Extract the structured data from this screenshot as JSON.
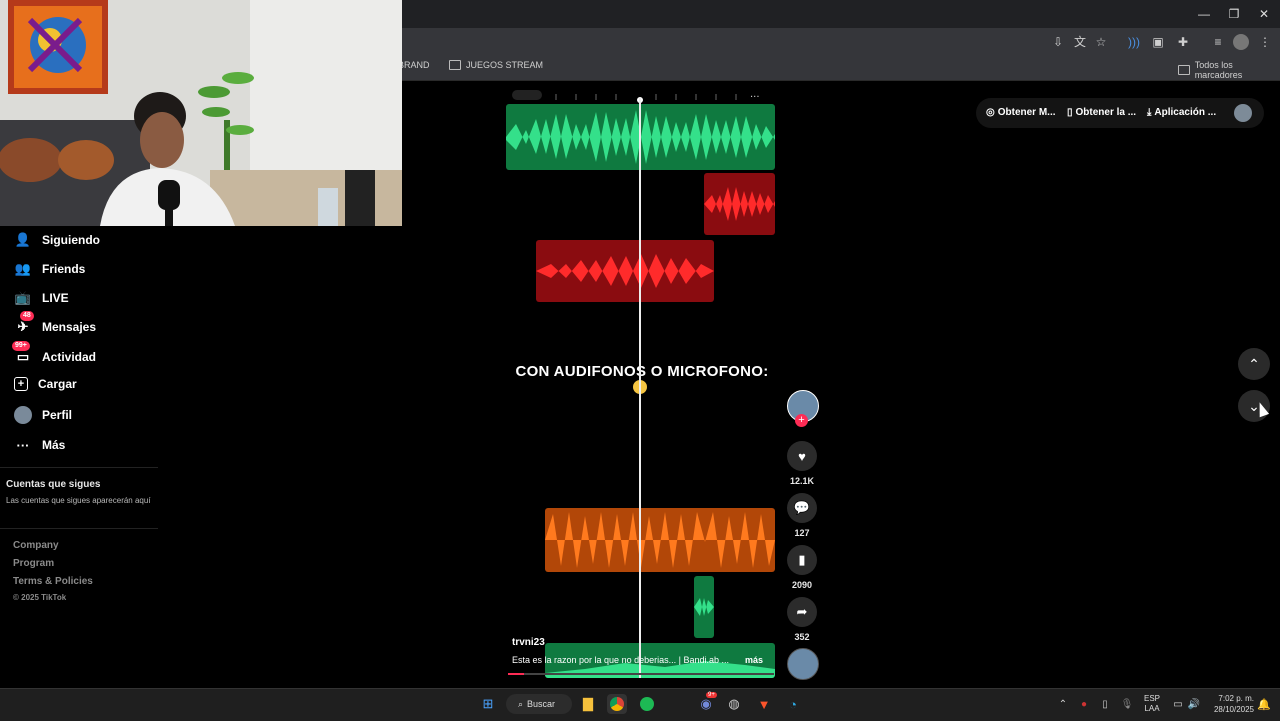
{
  "browser": {
    "bookmarks": [
      "BRAND",
      "JUEGOS STREAM"
    ],
    "all_bookmarks": "Todos los marcadores"
  },
  "sidebar": {
    "items": [
      {
        "label": "Siguiendo",
        "icon": "following-icon"
      },
      {
        "label": "Friends",
        "icon": "friends-icon"
      },
      {
        "label": "LIVE",
        "icon": "live-icon"
      },
      {
        "label": "Mensajes",
        "icon": "messages-icon",
        "badge": "48"
      },
      {
        "label": "Actividad",
        "icon": "activity-icon",
        "badge": "99+"
      },
      {
        "label": "Cargar",
        "icon": "upload-icon"
      },
      {
        "label": "Perfil",
        "icon": "profile-avatar"
      },
      {
        "label": "Más",
        "icon": "more-icon"
      }
    ],
    "following_title": "Cuentas que sigues",
    "following_desc": "Las cuentas que sigues aparecerán aquí",
    "footer": [
      "Company",
      "Program",
      "Terms & Policies",
      "© 2025 TikTok"
    ]
  },
  "video": {
    "caption_overlay": "CON AUDIFONOS O MICROFONO:",
    "username": "trvni23",
    "description": "Esta es la razon por la que no deberias... | Bandi.ab ...",
    "more": "más",
    "progress_fraction": 0.06
  },
  "actions": {
    "likes": "12.1K",
    "comments": "127",
    "saves": "2090",
    "shares": "352"
  },
  "top_pill": {
    "items": [
      "Obtener M...",
      "Obtener la ...",
      "Aplicación ..."
    ]
  },
  "taskbar": {
    "search": "Buscar",
    "lang": "ESP",
    "region": "LAA",
    "time": "7:02 p. m.",
    "date": "28/10/2025",
    "discord_badge": "9+"
  },
  "colors": {
    "green": "#22c46a",
    "red": "#e0141c",
    "orange": "#ff6a14",
    "accent": "#fe2c55"
  }
}
